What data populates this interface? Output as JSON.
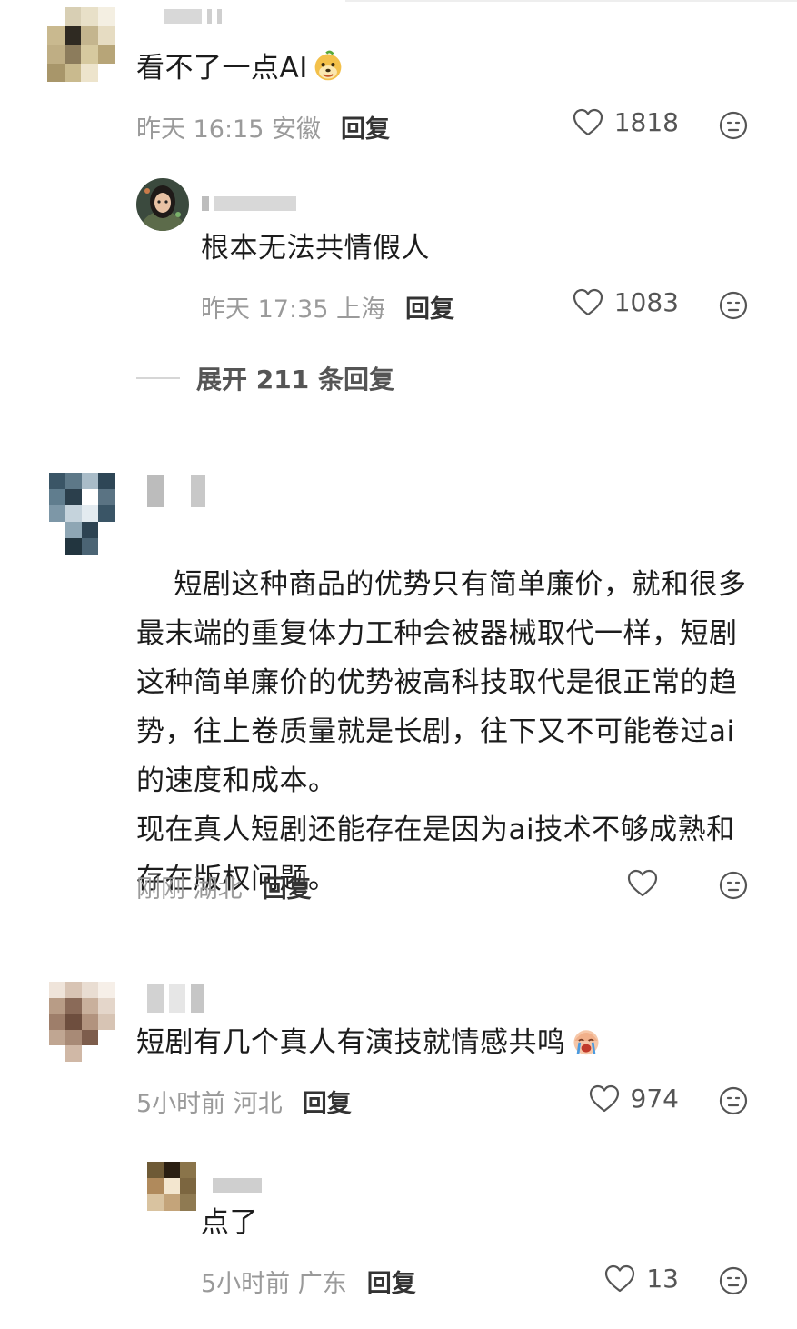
{
  "comments": [
    {
      "text": "看不了一点AI",
      "time": "昨天 16:15",
      "location": "安徽",
      "reply_label": "回复",
      "likes": "1818",
      "emoji_icon": "doge-face-emoji",
      "replies": [
        {
          "text": "根本无法共情假人",
          "time": "昨天 17:35",
          "location": "上海",
          "reply_label": "回复",
          "likes": "1083"
        }
      ],
      "expand_label": "展开 211 条回复"
    },
    {
      "text": "短剧这种商品的优势只有简单廉价，就和很多最末端的重复体力工种会被器械取代一样，短剧这种简单廉价的优势被高科技取代是很正常的趋势，往上卷质量就是长剧，往下又不可能卷过ai的速度和成本。\n现在真人短剧还能存在是因为ai技术不够成熟和存在版权问题。",
      "time": "刚刚",
      "location": "湖北",
      "reply_label": "回复",
      "likes": ""
    },
    {
      "text": "短剧有几个真人有演技就情感共鸣",
      "time": "5小时前",
      "location": "河北",
      "reply_label": "回复",
      "likes": "974",
      "emoji_icon": "crying-face-emoji",
      "replies": [
        {
          "text": "点了",
          "time": "5小时前",
          "location": "广东",
          "reply_label": "回复",
          "likes": "13"
        }
      ]
    }
  ],
  "colors": {
    "text": "#1c1c1c",
    "meta": "#9a9a9a",
    "icon": "#555555"
  }
}
